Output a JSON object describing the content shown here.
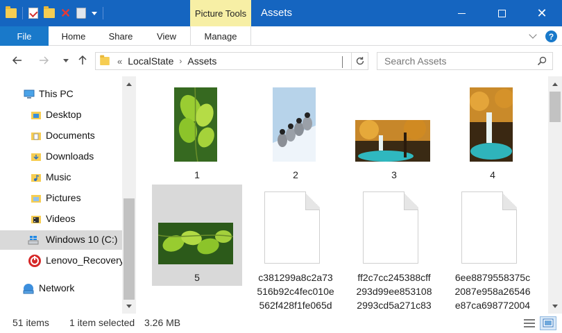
{
  "window": {
    "title": "Assets",
    "context_tab": "Picture Tools"
  },
  "ribbon": {
    "tabs": [
      {
        "label": "File"
      },
      {
        "label": "Home"
      },
      {
        "label": "Share"
      },
      {
        "label": "View"
      },
      {
        "label": "Manage"
      }
    ]
  },
  "address": {
    "overflow": "«",
    "crumbs": [
      "LocalState",
      "Assets"
    ],
    "separator": "›"
  },
  "search": {
    "placeholder": "Search Assets"
  },
  "nav_tree": [
    {
      "label": "This PC",
      "icon": "pc-icon"
    },
    {
      "label": "Desktop",
      "icon": "desktop-folder-icon"
    },
    {
      "label": "Documents",
      "icon": "documents-folder-icon"
    },
    {
      "label": "Downloads",
      "icon": "downloads-folder-icon"
    },
    {
      "label": "Music",
      "icon": "music-folder-icon"
    },
    {
      "label": "Pictures",
      "icon": "pictures-folder-icon"
    },
    {
      "label": "Videos",
      "icon": "videos-folder-icon"
    },
    {
      "label": "Windows 10 (C:)",
      "icon": "drive-icon",
      "selected": true
    },
    {
      "label": "Lenovo_Recovery",
      "icon": "recovery-drive-icon"
    },
    {
      "label": "Network",
      "icon": "network-icon"
    }
  ],
  "files": [
    {
      "label": "1",
      "kind": "image",
      "subject": "green leaves"
    },
    {
      "label": "2",
      "kind": "image",
      "subject": "penguins"
    },
    {
      "label": "3",
      "kind": "image",
      "subject": "autumn waterfall"
    },
    {
      "label": "4",
      "kind": "image",
      "subject": "autumn waterfall portrait"
    },
    {
      "label": "5",
      "kind": "image",
      "subject": "green leaves landscape",
      "selected": true
    },
    {
      "label_lines": [
        "c381299a8c2a73",
        "516b92c4fec010e",
        "562f428f1fe065d"
      ],
      "kind": "document"
    },
    {
      "label_lines": [
        "ff2c7cc245388cff",
        "293d99ee853108",
        "2993cd5a271c83"
      ],
      "kind": "document"
    },
    {
      "label_lines": [
        "6ee8879558375c",
        "2087e958a26546",
        "e87ca698772004"
      ],
      "kind": "document"
    }
  ],
  "status": {
    "items_count": "51 items",
    "selection": "1 item selected",
    "size": "3.26 MB"
  },
  "colors": {
    "titlebar": "#1565c0",
    "file_tab": "#1979ca",
    "context_tab": "#f7efa5",
    "selection": "#d9d9d9"
  }
}
